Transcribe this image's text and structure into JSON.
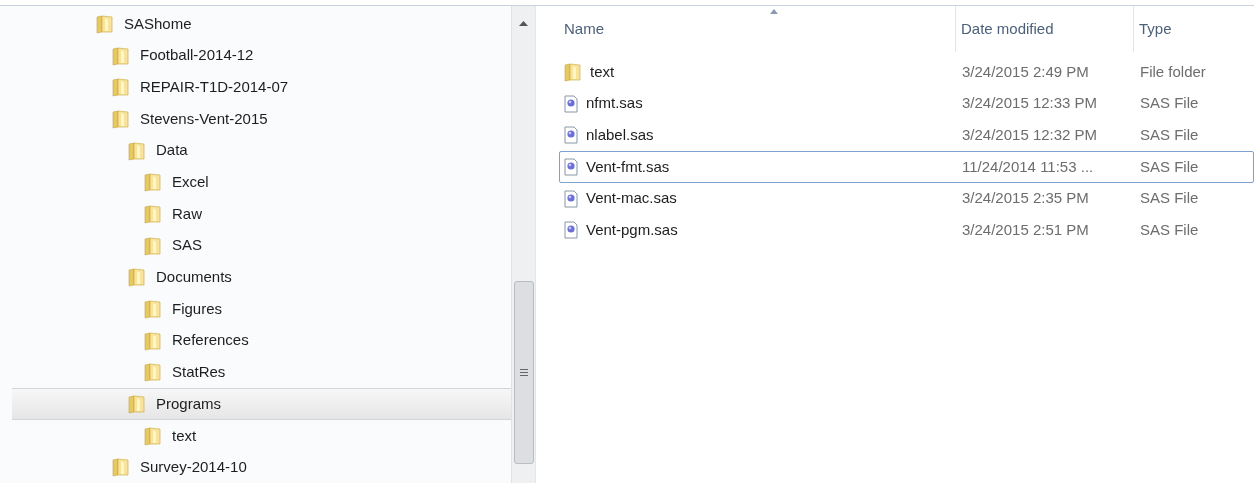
{
  "tree": [
    {
      "label": "SAShome",
      "selected": false,
      "children": [
        {
          "label": "Football-2014-12",
          "selected": false
        },
        {
          "label": "REPAIR-T1D-2014-07",
          "selected": false
        },
        {
          "label": "Stevens-Vent-2015",
          "selected": false,
          "children": [
            {
              "label": "Data",
              "selected": false,
              "children": [
                {
                  "label": "Excel",
                  "selected": false
                },
                {
                  "label": "Raw",
                  "selected": false
                },
                {
                  "label": "SAS",
                  "selected": false
                }
              ]
            },
            {
              "label": "Documents",
              "selected": false,
              "children": [
                {
                  "label": "Figures",
                  "selected": false
                },
                {
                  "label": "References",
                  "selected": false
                },
                {
                  "label": "StatRes",
                  "selected": false
                }
              ]
            },
            {
              "label": "Programs",
              "selected": true,
              "children": [
                {
                  "label": "text",
                  "selected": false
                }
              ]
            }
          ]
        },
        {
          "label": "Survey-2014-10",
          "selected": false
        }
      ]
    }
  ],
  "file_list": {
    "columns": [
      "Name",
      "Date modified",
      "Type"
    ],
    "rows": [
      {
        "kind": "folder",
        "name": "text",
        "date": "3/24/2015 2:49 PM",
        "type": "File folder",
        "focused": false
      },
      {
        "kind": "sas",
        "name": "nfmt.sas",
        "date": "3/24/2015 12:33 PM",
        "type": "SAS File",
        "focused": false
      },
      {
        "kind": "sas",
        "name": "nlabel.sas",
        "date": "3/24/2015 12:32 PM",
        "type": "SAS File",
        "focused": false
      },
      {
        "kind": "sas",
        "name": "Vent-fmt.sas",
        "date": "11/24/2014 11:53 ...",
        "type": "SAS File",
        "focused": true
      },
      {
        "kind": "sas",
        "name": "Vent-mac.sas",
        "date": "3/24/2015 2:35 PM",
        "type": "SAS File",
        "focused": false
      },
      {
        "kind": "sas",
        "name": "Vent-pgm.sas",
        "date": "3/24/2015 2:51 PM",
        "type": "SAS File",
        "focused": false
      }
    ]
  }
}
